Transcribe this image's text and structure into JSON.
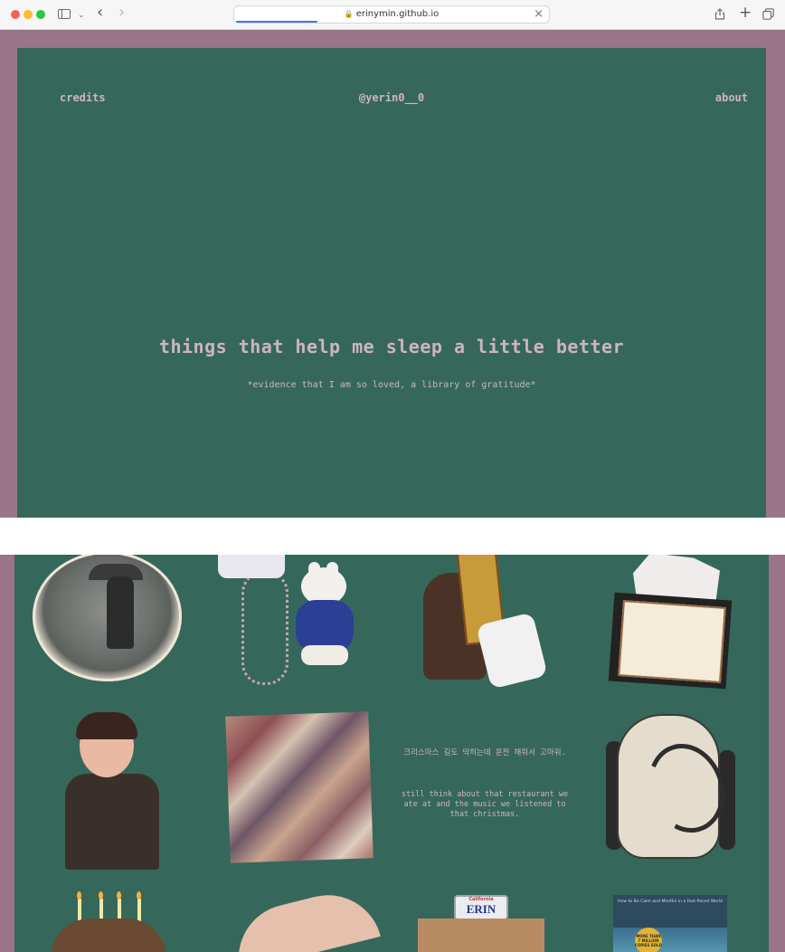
{
  "browser": {
    "url": "erinymin.github.io",
    "icons": [
      "sidebar-toggle-icon",
      "chevron-down-icon",
      "back-icon",
      "forward-icon",
      "lock-icon",
      "close-icon",
      "share-icon",
      "new-tab-icon",
      "tab-overview-icon"
    ]
  },
  "nav": {
    "credits": "credits",
    "handle": "@yerin0__0",
    "about": "about"
  },
  "hero": {
    "title": "things that help me sleep a little better",
    "subtitle": "*evidence that I am so loved, a library of gratitude*"
  },
  "gallery": {
    "note_korean": "크리스마스 길도 막히는데 운전 해줘서 고마워.",
    "note_english": "still think about that restaurant we ate at and the music we listened to that christmas.",
    "plate_state": "California",
    "plate_name": "ERIN",
    "book_title": "How to Be Calm and Mindful in a Fast-Paced World",
    "book_sticker": "MORE THAN 7 MILLION COPIES SOLD"
  },
  "colors": {
    "frame": "#9a7489",
    "panel": "#35685a",
    "text": "#cfb3c2"
  }
}
